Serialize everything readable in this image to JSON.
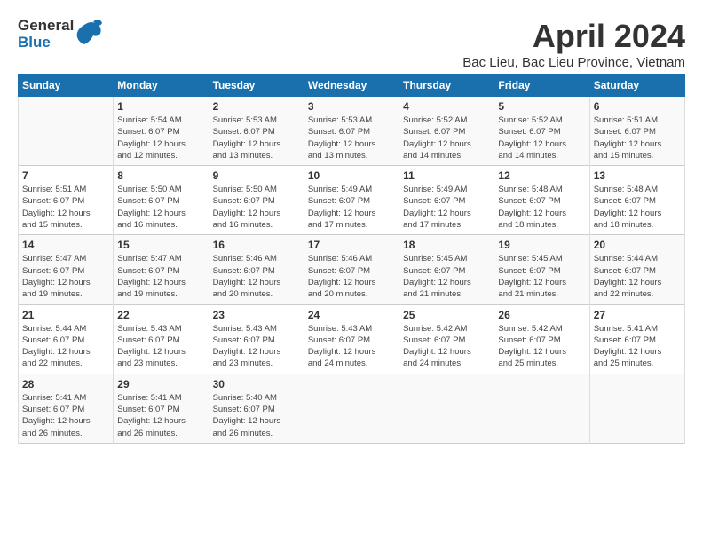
{
  "header": {
    "logo_general": "General",
    "logo_blue": "Blue",
    "title": "April 2024",
    "subtitle": "Bac Lieu, Bac Lieu Province, Vietnam"
  },
  "calendar": {
    "days_of_week": [
      "Sunday",
      "Monday",
      "Tuesday",
      "Wednesday",
      "Thursday",
      "Friday",
      "Saturday"
    ],
    "weeks": [
      [
        {
          "day": "",
          "text": ""
        },
        {
          "day": "1",
          "text": "Sunrise: 5:54 AM\nSunset: 6:07 PM\nDaylight: 12 hours\nand 12 minutes."
        },
        {
          "day": "2",
          "text": "Sunrise: 5:53 AM\nSunset: 6:07 PM\nDaylight: 12 hours\nand 13 minutes."
        },
        {
          "day": "3",
          "text": "Sunrise: 5:53 AM\nSunset: 6:07 PM\nDaylight: 12 hours\nand 13 minutes."
        },
        {
          "day": "4",
          "text": "Sunrise: 5:52 AM\nSunset: 6:07 PM\nDaylight: 12 hours\nand 14 minutes."
        },
        {
          "day": "5",
          "text": "Sunrise: 5:52 AM\nSunset: 6:07 PM\nDaylight: 12 hours\nand 14 minutes."
        },
        {
          "day": "6",
          "text": "Sunrise: 5:51 AM\nSunset: 6:07 PM\nDaylight: 12 hours\nand 15 minutes."
        }
      ],
      [
        {
          "day": "7",
          "text": "Sunrise: 5:51 AM\nSunset: 6:07 PM\nDaylight: 12 hours\nand 15 minutes."
        },
        {
          "day": "8",
          "text": "Sunrise: 5:50 AM\nSunset: 6:07 PM\nDaylight: 12 hours\nand 16 minutes."
        },
        {
          "day": "9",
          "text": "Sunrise: 5:50 AM\nSunset: 6:07 PM\nDaylight: 12 hours\nand 16 minutes."
        },
        {
          "day": "10",
          "text": "Sunrise: 5:49 AM\nSunset: 6:07 PM\nDaylight: 12 hours\nand 17 minutes."
        },
        {
          "day": "11",
          "text": "Sunrise: 5:49 AM\nSunset: 6:07 PM\nDaylight: 12 hours\nand 17 minutes."
        },
        {
          "day": "12",
          "text": "Sunrise: 5:48 AM\nSunset: 6:07 PM\nDaylight: 12 hours\nand 18 minutes."
        },
        {
          "day": "13",
          "text": "Sunrise: 5:48 AM\nSunset: 6:07 PM\nDaylight: 12 hours\nand 18 minutes."
        }
      ],
      [
        {
          "day": "14",
          "text": "Sunrise: 5:47 AM\nSunset: 6:07 PM\nDaylight: 12 hours\nand 19 minutes."
        },
        {
          "day": "15",
          "text": "Sunrise: 5:47 AM\nSunset: 6:07 PM\nDaylight: 12 hours\nand 19 minutes."
        },
        {
          "day": "16",
          "text": "Sunrise: 5:46 AM\nSunset: 6:07 PM\nDaylight: 12 hours\nand 20 minutes."
        },
        {
          "day": "17",
          "text": "Sunrise: 5:46 AM\nSunset: 6:07 PM\nDaylight: 12 hours\nand 20 minutes."
        },
        {
          "day": "18",
          "text": "Sunrise: 5:45 AM\nSunset: 6:07 PM\nDaylight: 12 hours\nand 21 minutes."
        },
        {
          "day": "19",
          "text": "Sunrise: 5:45 AM\nSunset: 6:07 PM\nDaylight: 12 hours\nand 21 minutes."
        },
        {
          "day": "20",
          "text": "Sunrise: 5:44 AM\nSunset: 6:07 PM\nDaylight: 12 hours\nand 22 minutes."
        }
      ],
      [
        {
          "day": "21",
          "text": "Sunrise: 5:44 AM\nSunset: 6:07 PM\nDaylight: 12 hours\nand 22 minutes."
        },
        {
          "day": "22",
          "text": "Sunrise: 5:43 AM\nSunset: 6:07 PM\nDaylight: 12 hours\nand 23 minutes."
        },
        {
          "day": "23",
          "text": "Sunrise: 5:43 AM\nSunset: 6:07 PM\nDaylight: 12 hours\nand 23 minutes."
        },
        {
          "day": "24",
          "text": "Sunrise: 5:43 AM\nSunset: 6:07 PM\nDaylight: 12 hours\nand 24 minutes."
        },
        {
          "day": "25",
          "text": "Sunrise: 5:42 AM\nSunset: 6:07 PM\nDaylight: 12 hours\nand 24 minutes."
        },
        {
          "day": "26",
          "text": "Sunrise: 5:42 AM\nSunset: 6:07 PM\nDaylight: 12 hours\nand 25 minutes."
        },
        {
          "day": "27",
          "text": "Sunrise: 5:41 AM\nSunset: 6:07 PM\nDaylight: 12 hours\nand 25 minutes."
        }
      ],
      [
        {
          "day": "28",
          "text": "Sunrise: 5:41 AM\nSunset: 6:07 PM\nDaylight: 12 hours\nand 26 minutes."
        },
        {
          "day": "29",
          "text": "Sunrise: 5:41 AM\nSunset: 6:07 PM\nDaylight: 12 hours\nand 26 minutes."
        },
        {
          "day": "30",
          "text": "Sunrise: 5:40 AM\nSunset: 6:07 PM\nDaylight: 12 hours\nand 26 minutes."
        },
        {
          "day": "",
          "text": ""
        },
        {
          "day": "",
          "text": ""
        },
        {
          "day": "",
          "text": ""
        },
        {
          "day": "",
          "text": ""
        }
      ]
    ]
  }
}
